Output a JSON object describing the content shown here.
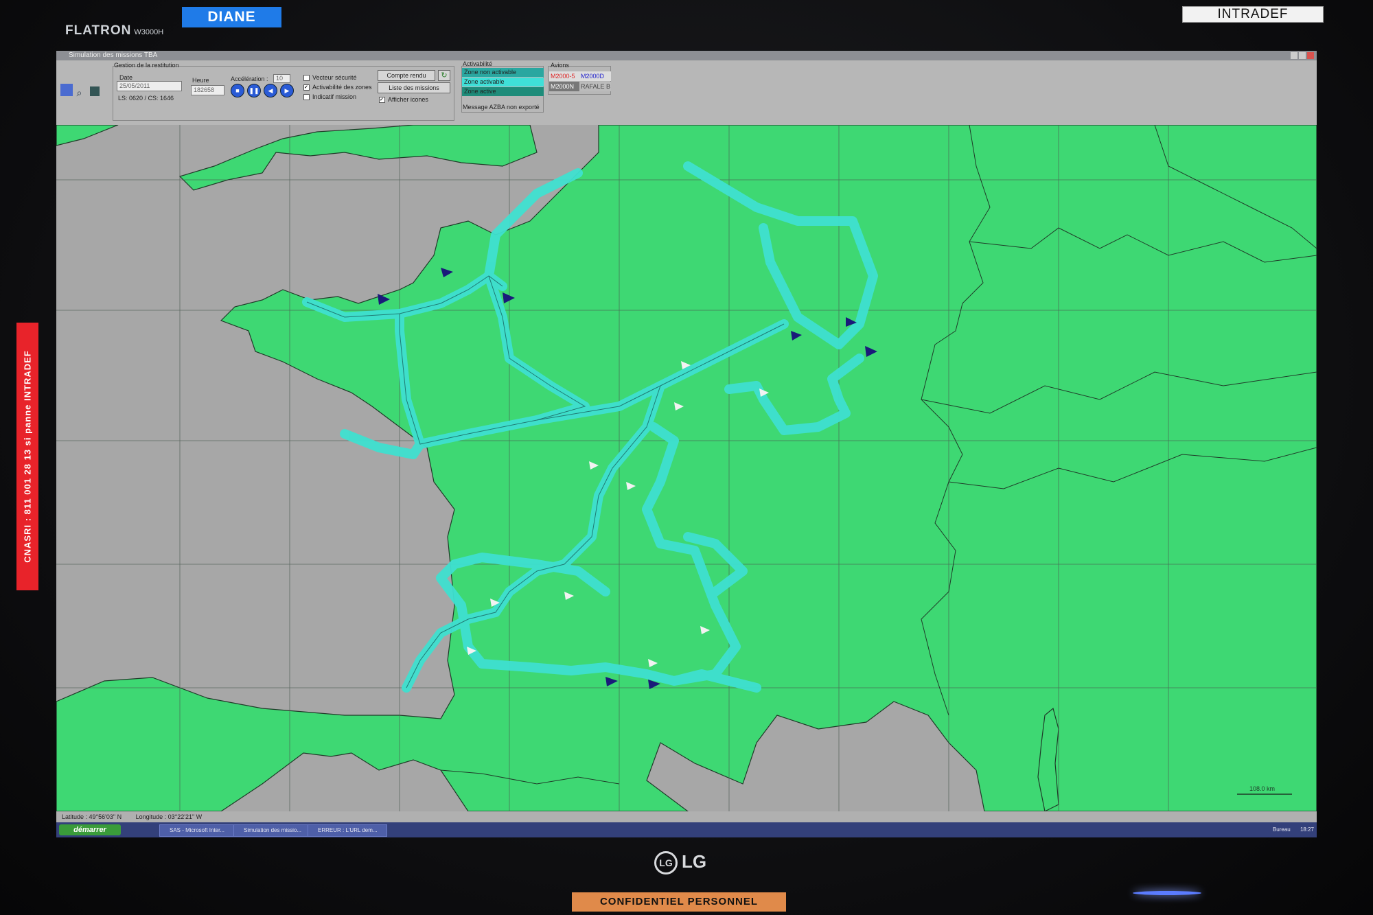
{
  "monitor": {
    "brand": "FLATRON",
    "model": "W3000H",
    "maker": "LG",
    "sticker_top_left": "DIANE",
    "sticker_top_right": "INTRADEF",
    "sticker_side": "CNASRI : 811 001 28 13 si panne INTRADEF",
    "sticker_bottom": "CONFIDENTIEL PERSONNEL"
  },
  "window": {
    "title": "Simulation des missions TBA"
  },
  "toolbar": {
    "group_title": "Gestion de la restitution",
    "date_label": "Date",
    "date_value": "25/05/2011",
    "ls_cs": "LS: 0620 / CS: 1646",
    "heure_label": "Heure",
    "heure_value": "182658",
    "acceleration_label": "Accélération :",
    "acceleration_value": "10",
    "play_controls": [
      "■",
      "❚❚",
      "◀",
      "▶"
    ],
    "checkboxes": [
      {
        "label": "Vecteur sécurité",
        "checked": false
      },
      {
        "label": "Activabilité des zones",
        "checked": true
      },
      {
        "label": "Indicatif mission",
        "checked": false
      }
    ],
    "compte_rendu_button": "Compte rendu",
    "liste_missions_button": "Liste des missions",
    "afficher_icones": {
      "label": "Afficher icones",
      "checked": true
    },
    "activabilite": {
      "title": "Activabilité",
      "items": [
        {
          "label": "Zone non activable",
          "color": "#2aa7a0"
        },
        {
          "label": "Zone activable",
          "color": "#3fe0d8"
        },
        {
          "label": "Zone active",
          "color": "#1e8c7a"
        }
      ],
      "message": "Message AZBA non exporté"
    },
    "avions": {
      "title": "Avions",
      "items": [
        {
          "label": "M2000-5",
          "color": "#d22"
        },
        {
          "label": "M2000D",
          "color": "#22c"
        },
        {
          "label": "M2000N",
          "color": "#555"
        },
        {
          "label": "RAFALE B",
          "color": "#555"
        }
      ]
    }
  },
  "map": {
    "land_color": "#3ed873",
    "sea_color": "#a7a7a7",
    "route_color": "#3fe0d0",
    "scale_label": "108.0 km"
  },
  "status": {
    "latitude": "Latitude : 49°56'03\" N",
    "longitude": "Longitude : 03°22'21\" W"
  },
  "taskbar": {
    "start": "démarrer",
    "tasks": [
      "SAS - Microsoft Inter...",
      "Simulation des missio...",
      "ERREUR : L'URL dem..."
    ],
    "tray_label": "Bureau",
    "clock": "18:27"
  }
}
